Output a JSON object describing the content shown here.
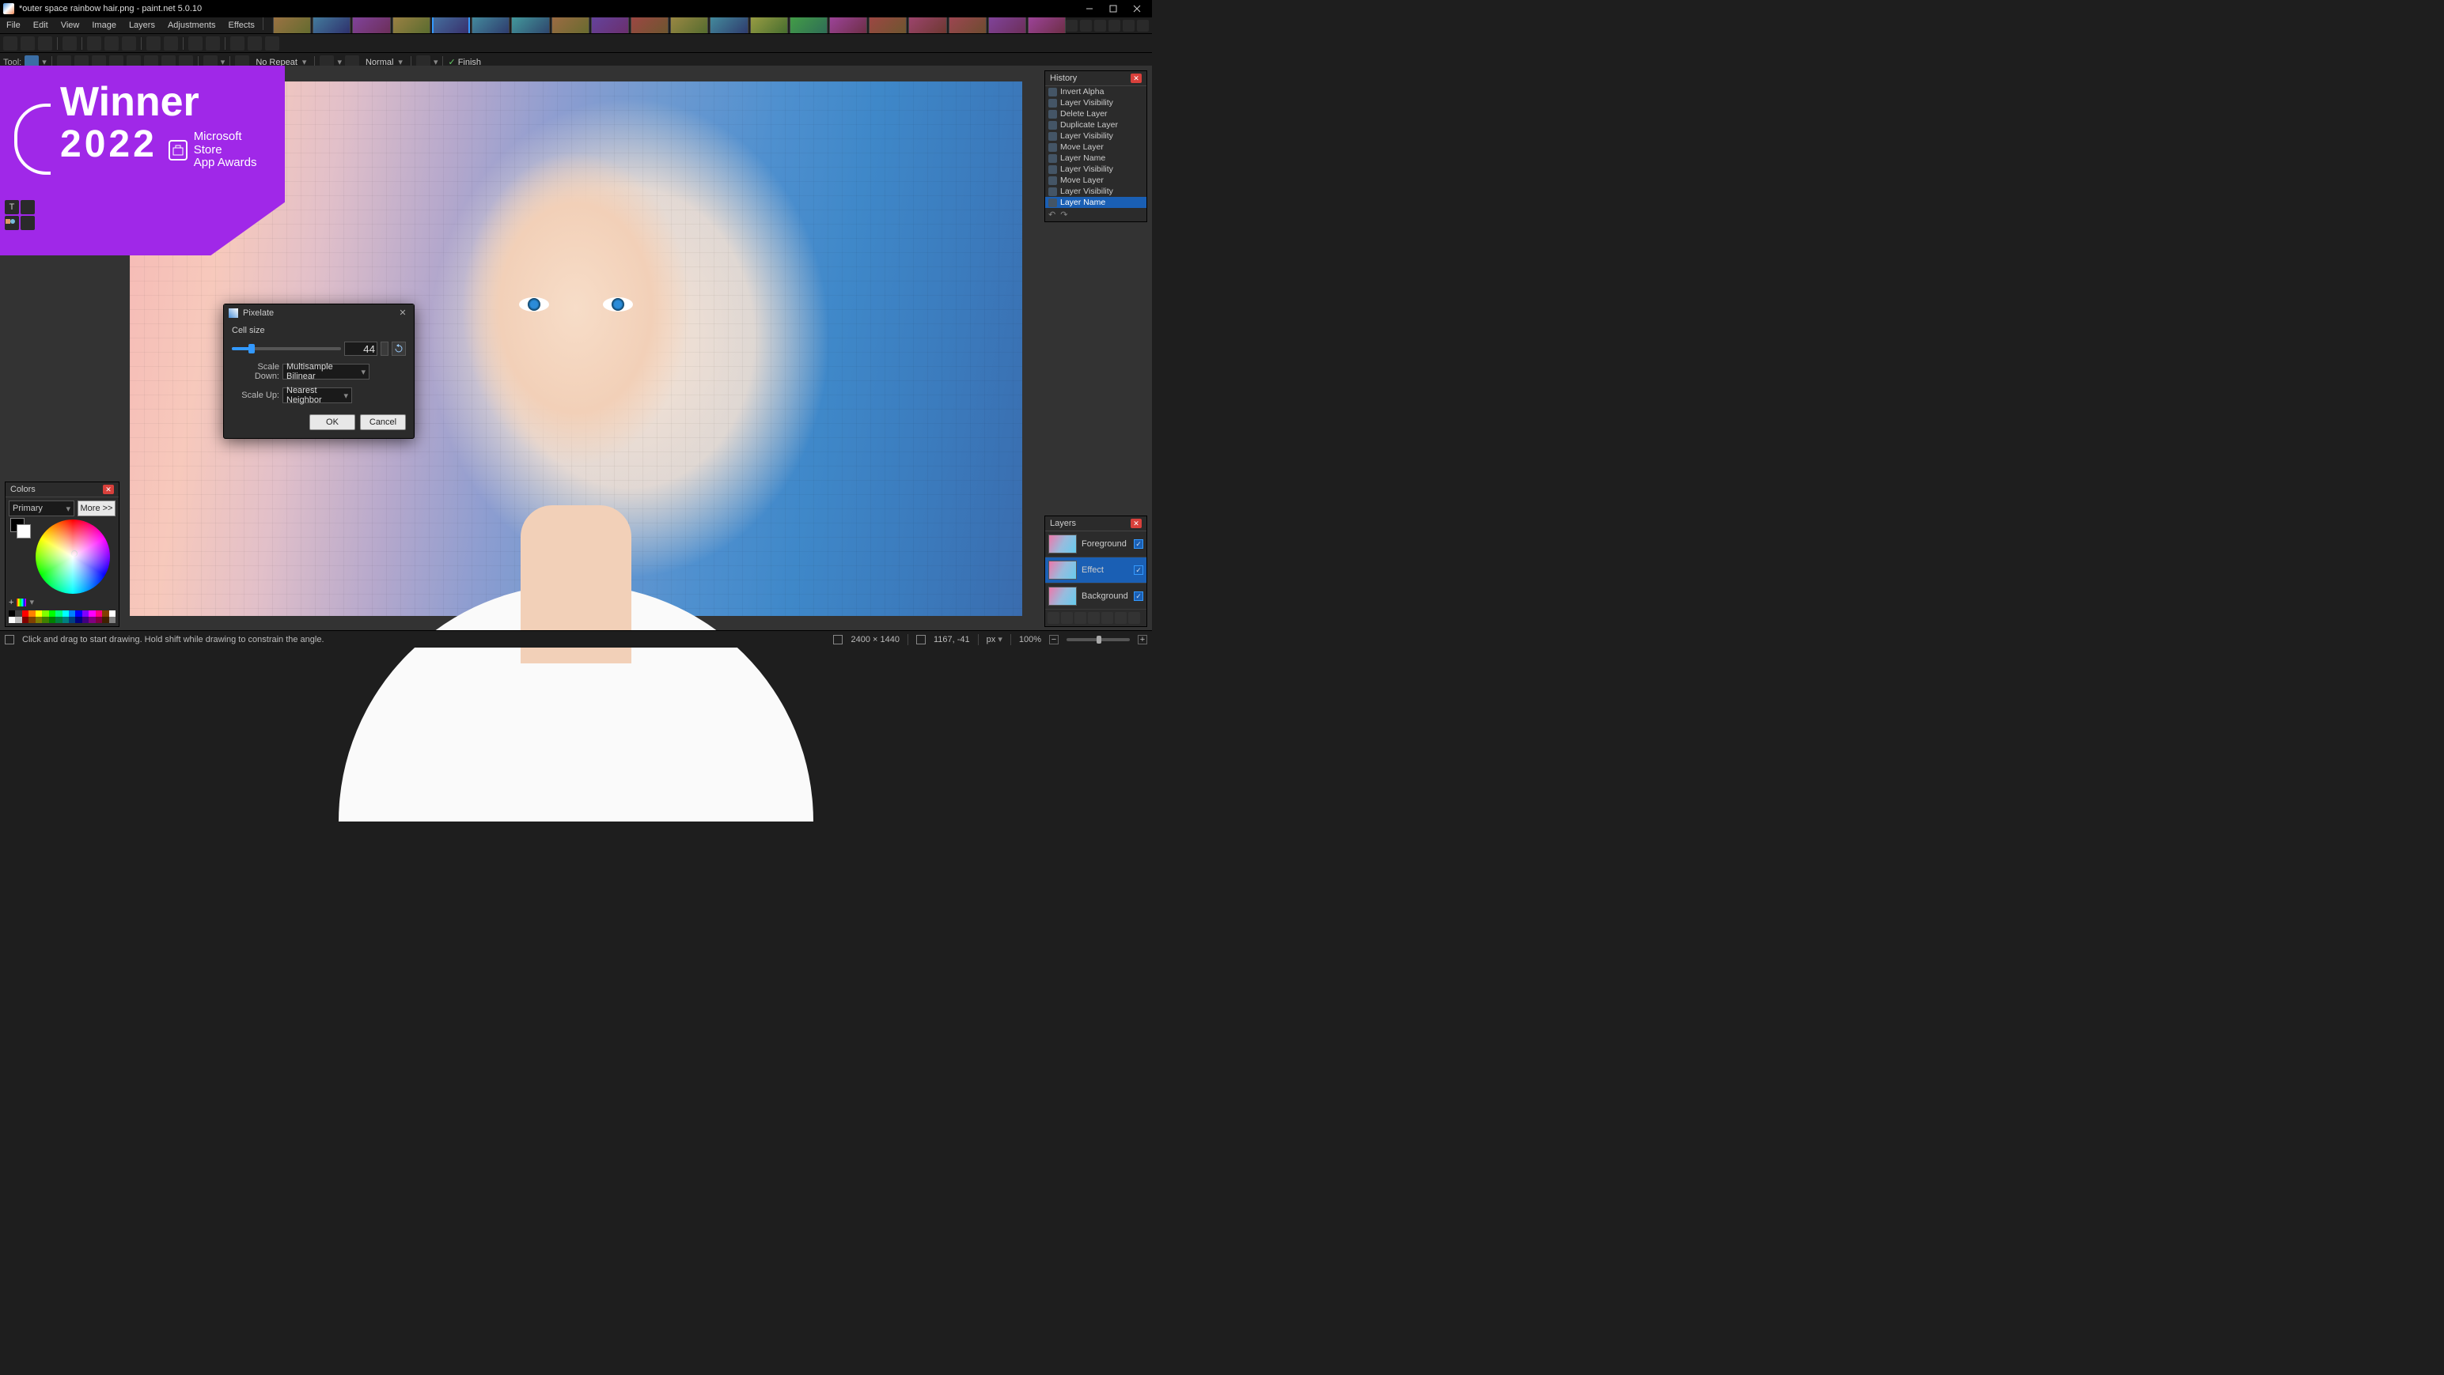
{
  "title": "*outer space rainbow hair.png - paint.net 5.0.10",
  "menu": [
    "File",
    "Edit",
    "View",
    "Image",
    "Layers",
    "Adjustments",
    "Effects"
  ],
  "util_icons": [
    "pointer-icon",
    "globe-icon",
    "clock-icon",
    "target-icon",
    "gear-icon",
    "gear2-icon"
  ],
  "toolbar1": {
    "tool_label": "Tool:",
    "blend_label": "No Repeat",
    "mode_label": "Normal",
    "finish_label": "Finish"
  },
  "badge": {
    "line1": "Winner",
    "line2": "2022",
    "sub1": "Microsoft Store",
    "sub2": "App Awards"
  },
  "dialog": {
    "title": "Pixelate",
    "cell_size_label": "Cell size",
    "cell_size_value": "44",
    "slider_pct": 18,
    "scale_down_label": "Scale Down:",
    "scale_down_value": "Multisample Bilinear",
    "scale_up_label": "Scale Up:",
    "scale_up_value": "Nearest Neighbor",
    "ok": "OK",
    "cancel": "Cancel"
  },
  "history": {
    "title": "History",
    "items": [
      {
        "label": "Invert Alpha"
      },
      {
        "label": "Layer Visibility"
      },
      {
        "label": "Delete Layer"
      },
      {
        "label": "Duplicate Layer"
      },
      {
        "label": "Layer Visibility"
      },
      {
        "label": "Move Layer"
      },
      {
        "label": "Layer Name"
      },
      {
        "label": "Layer Visibility"
      },
      {
        "label": "Move Layer"
      },
      {
        "label": "Layer Visibility"
      },
      {
        "label": "Layer Name",
        "selected": true
      }
    ]
  },
  "layers": {
    "title": "Layers",
    "items": [
      {
        "name": "Foreground"
      },
      {
        "name": "Effect",
        "selected": true
      },
      {
        "name": "Background"
      }
    ]
  },
  "colors": {
    "title": "Colors",
    "primary_label": "Primary",
    "more_label": "More >>",
    "palette": [
      "#000000",
      "#404040",
      "#ff0000",
      "#ff8000",
      "#ffff00",
      "#80ff00",
      "#00ff00",
      "#00ff80",
      "#00ffff",
      "#0080ff",
      "#0000ff",
      "#8000ff",
      "#ff00ff",
      "#ff0080",
      "#804000",
      "#ffffff",
      "#ffffff",
      "#c0c0c0",
      "#800000",
      "#804000",
      "#808000",
      "#408000",
      "#008000",
      "#008040",
      "#008080",
      "#004080",
      "#000080",
      "#400080",
      "#800080",
      "#800040",
      "#402000",
      "#808080"
    ]
  },
  "status": {
    "hint": "Click and drag to start drawing. Hold shift while drawing to constrain the angle.",
    "dims": "2400 × 1440",
    "cursor": "1167, -41",
    "px_label": "px",
    "zoom": "100%"
  },
  "thumbs_count": 20,
  "thumbs_active_index": 4
}
